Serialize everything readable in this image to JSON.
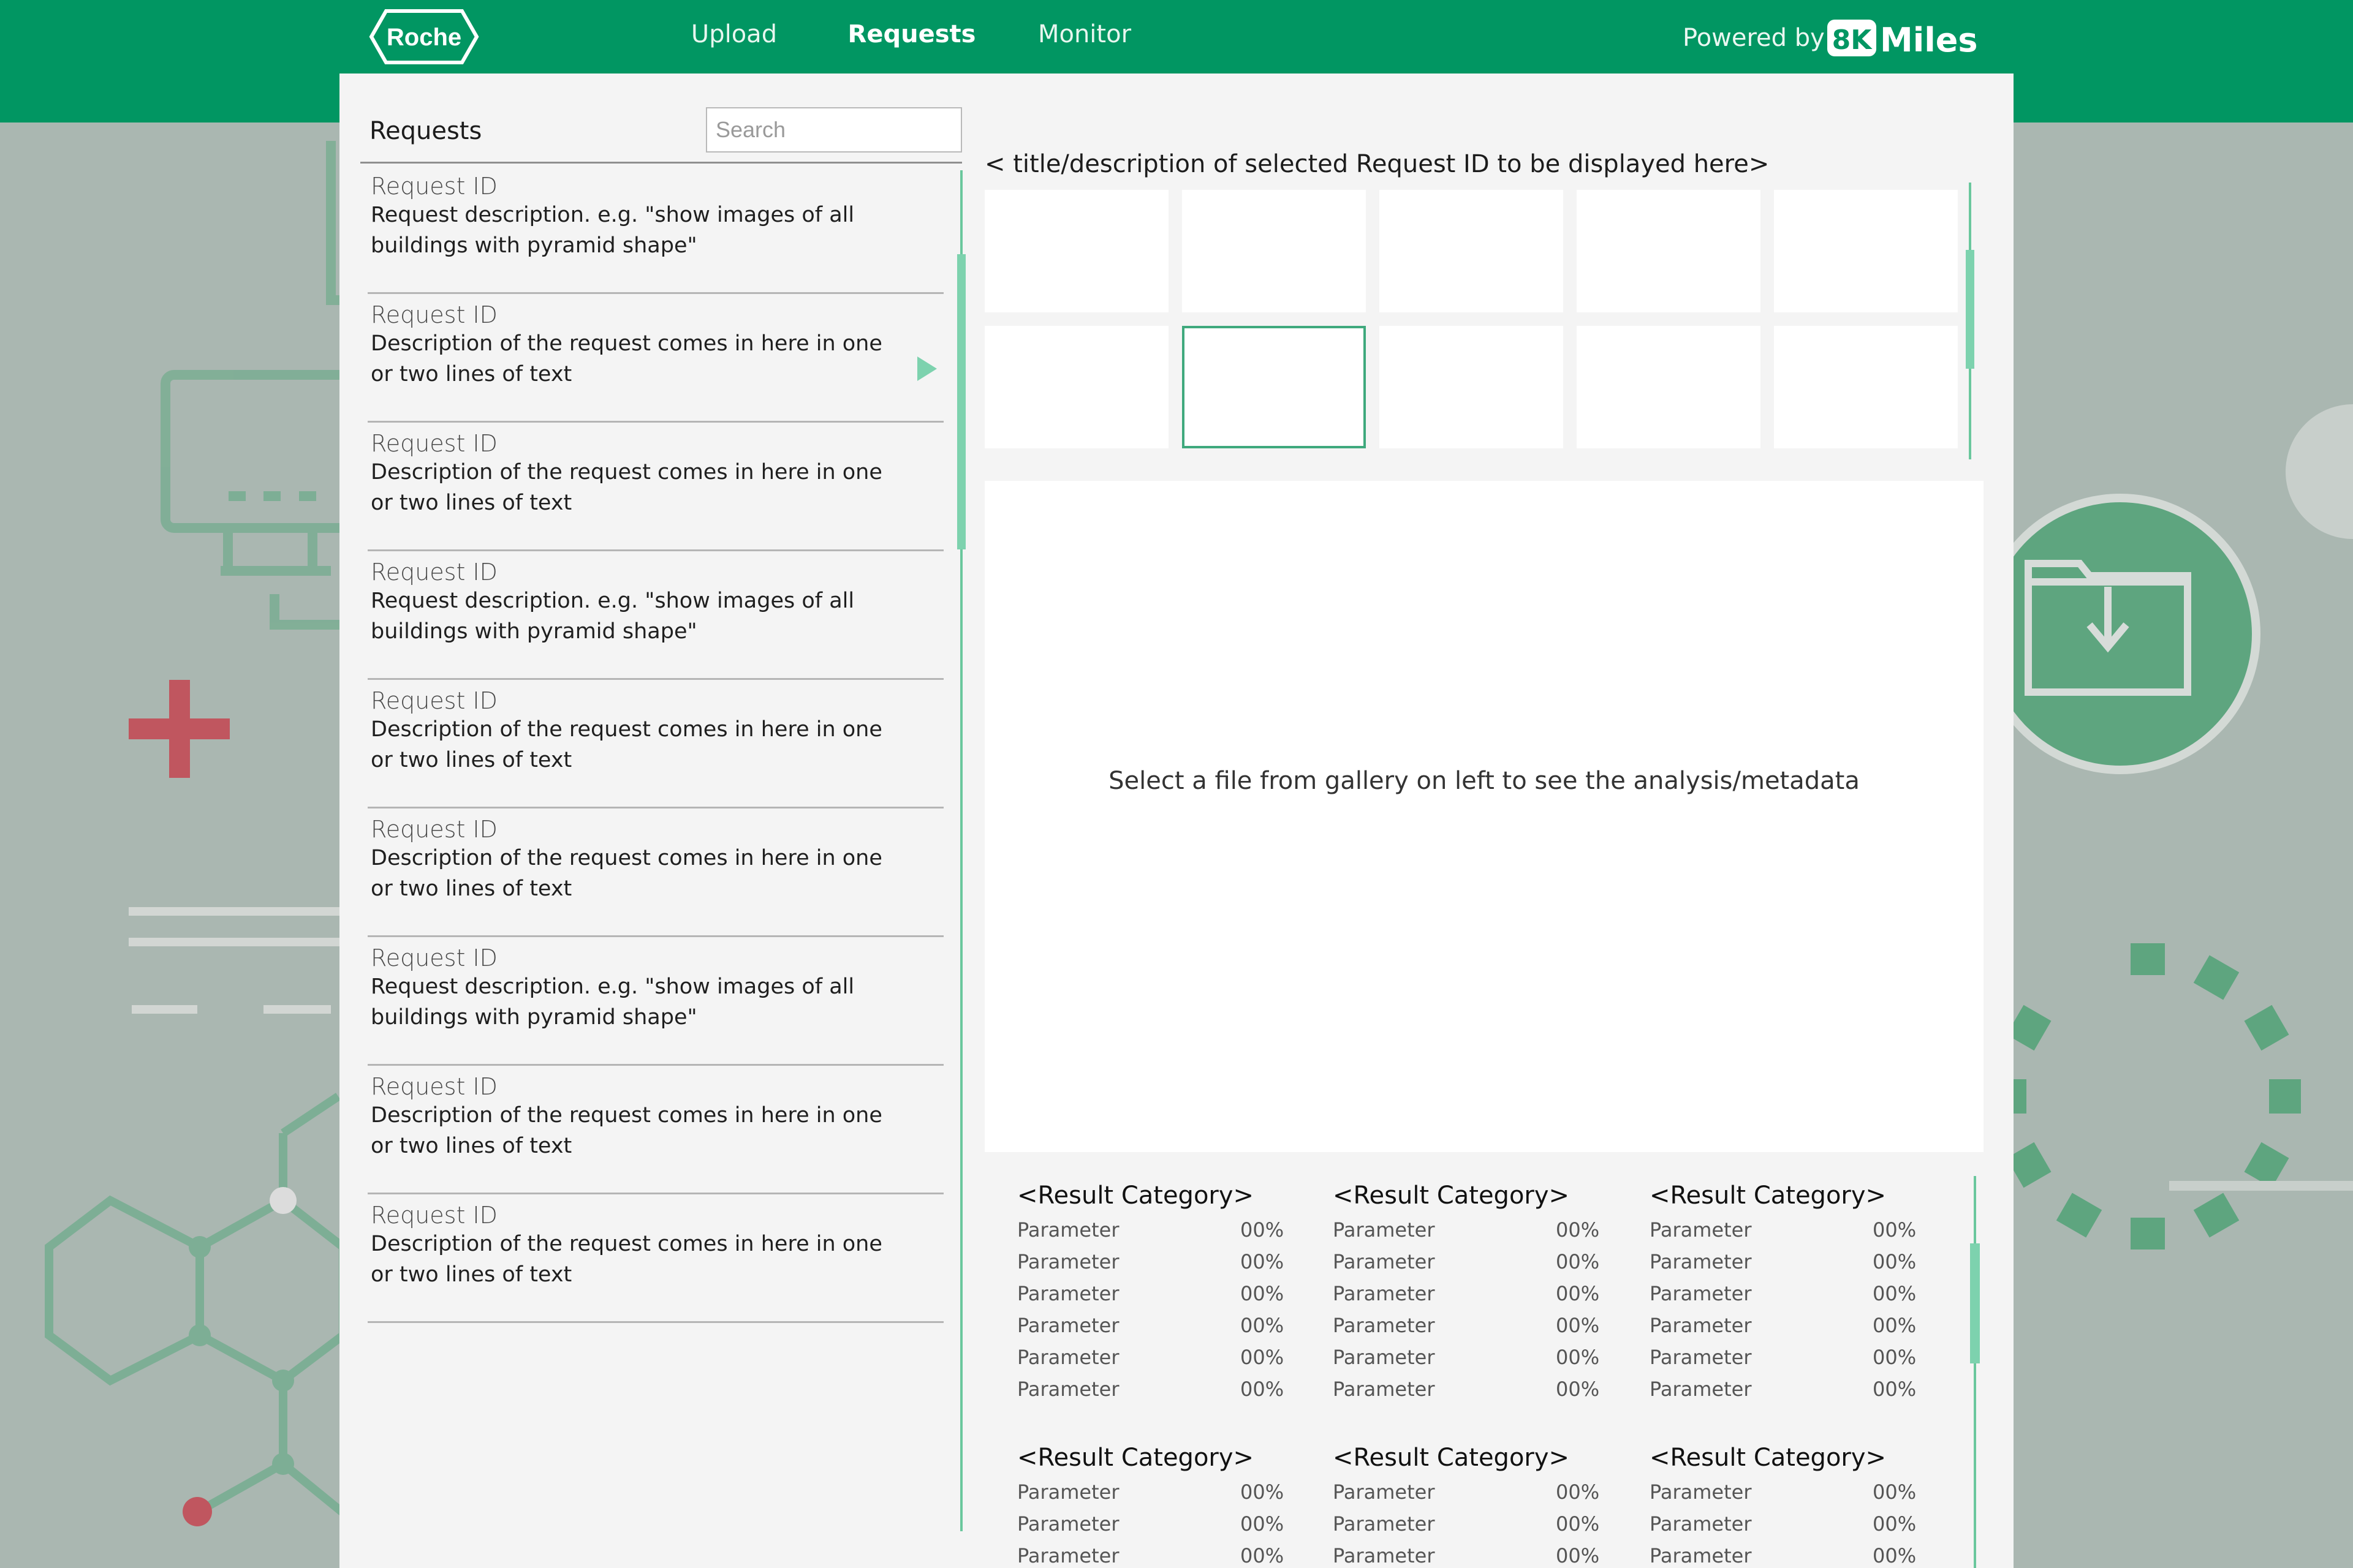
{
  "brand": {
    "logo_text": "Roche",
    "powered_by": "Powered by",
    "partner_logo": "8K Miles",
    "partner_logo_icon": "8K",
    "partner_logo_word": "Miles"
  },
  "nav": {
    "tabs": [
      {
        "label": "Upload"
      },
      {
        "label": "Requests",
        "active": true
      },
      {
        "label": "Monitor"
      }
    ]
  },
  "requests": {
    "heading": "Requests",
    "search_placeholder": "Search",
    "items": [
      {
        "id": "Request ID",
        "description": "Request description. e.g. \"show images of all buildings with pyramid shape\""
      },
      {
        "id": "Request ID",
        "description": "Description of the request comes in here in one or two lines of text",
        "selected": true
      },
      {
        "id": "Request ID",
        "description": "Description of the request comes in here in one or two lines of text"
      },
      {
        "id": "Request ID",
        "description": "Request description. e.g. \"show images of all buildings with pyramid shape\""
      },
      {
        "id": "Request ID",
        "description": "Description of the request comes in here in one or two lines of text"
      },
      {
        "id": "Request ID",
        "description": "Description of the request comes in here in one or two lines of text"
      },
      {
        "id": "Request ID",
        "description": "Request description. e.g. \"show images of all buildings with pyramid shape\""
      },
      {
        "id": "Request ID",
        "description": "Description of the request comes in here in one or two lines of text"
      },
      {
        "id": "Request ID",
        "description": "Description of the request comes in here in one or two lines of text"
      }
    ]
  },
  "detail": {
    "title": "< title/description of selected Request ID to be displayed here>",
    "gallery": {
      "count": 10,
      "selected_index": 6
    },
    "placeholder": "Select a file from gallery on left to see the analysis/metadata"
  },
  "results": {
    "categories": [
      {
        "title": "<Result Category>",
        "rows": [
          {
            "param": "Parameter",
            "value": "00%"
          },
          {
            "param": "Parameter",
            "value": "00%"
          },
          {
            "param": "Parameter",
            "value": "00%"
          },
          {
            "param": "Parameter",
            "value": "00%"
          },
          {
            "param": "Parameter",
            "value": "00%"
          },
          {
            "param": "Parameter",
            "value": "00%"
          }
        ]
      },
      {
        "title": "<Result Category>",
        "rows": [
          {
            "param": "Parameter",
            "value": "00%"
          },
          {
            "param": "Parameter",
            "value": "00%"
          },
          {
            "param": "Parameter",
            "value": "00%"
          },
          {
            "param": "Parameter",
            "value": "00%"
          },
          {
            "param": "Parameter",
            "value": "00%"
          },
          {
            "param": "Parameter",
            "value": "00%"
          }
        ]
      },
      {
        "title": "<Result Category>",
        "rows": [
          {
            "param": "Parameter",
            "value": "00%"
          },
          {
            "param": "Parameter",
            "value": "00%"
          },
          {
            "param": "Parameter",
            "value": "00%"
          },
          {
            "param": "Parameter",
            "value": "00%"
          },
          {
            "param": "Parameter",
            "value": "00%"
          },
          {
            "param": "Parameter",
            "value": "00%"
          }
        ]
      },
      {
        "title": "<Result Category>",
        "rows": [
          {
            "param": "Parameter",
            "value": "00%"
          },
          {
            "param": "Parameter",
            "value": "00%"
          },
          {
            "param": "Parameter",
            "value": "00%"
          }
        ]
      },
      {
        "title": "<Result Category>",
        "rows": [
          {
            "param": "Parameter",
            "value": "00%"
          },
          {
            "param": "Parameter",
            "value": "00%"
          },
          {
            "param": "Parameter",
            "value": "00%"
          }
        ]
      },
      {
        "title": "<Result Category>",
        "rows": [
          {
            "param": "Parameter",
            "value": "00%"
          },
          {
            "param": "Parameter",
            "value": "00%"
          },
          {
            "param": "Parameter",
            "value": "00%"
          }
        ]
      }
    ]
  },
  "colors": {
    "primary": "#019662",
    "accent": "#7dd2ae",
    "panel": "#f4f4f4",
    "background": "#aab7b1",
    "red_accent": "#c0565f"
  },
  "icons": [
    "pharmacy-cross-icon",
    "computer-monitor-icon",
    "molecule-icon",
    "download-folder-icon",
    "loading-spinner-icon"
  ]
}
